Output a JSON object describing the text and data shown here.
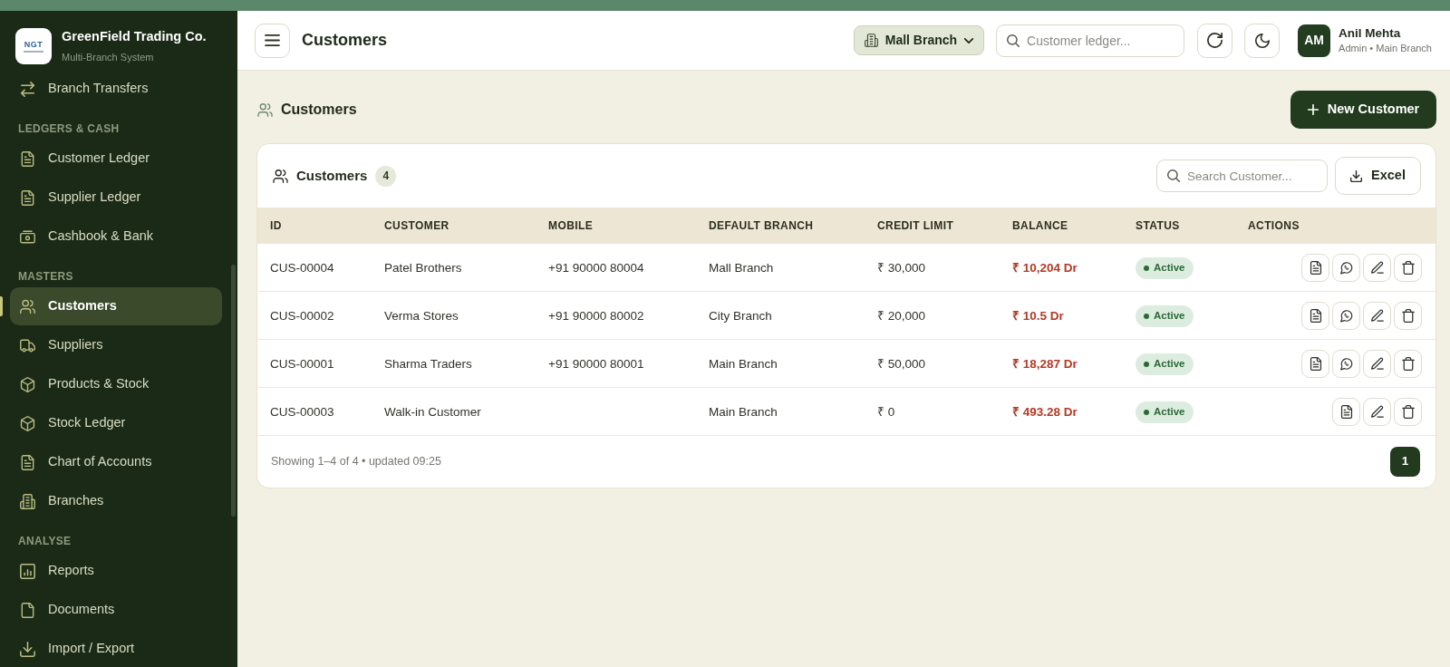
{
  "sidebar": {
    "brand": {
      "logo_text": "NGT",
      "name": "GreenField Trading Co.",
      "tagline": "Multi-Branch System"
    },
    "sections": [
      {
        "items": [
          {
            "label": "Branch Transfers",
            "selected": false
          }
        ]
      },
      {
        "heading": "LEDGERS & CASH",
        "items": [
          {
            "label": "Customer Ledger",
            "selected": false
          },
          {
            "label": "Supplier Ledger",
            "selected": false
          },
          {
            "label": "Cashbook & Bank",
            "selected": false
          }
        ]
      },
      {
        "heading": "MASTERS",
        "items": [
          {
            "label": "Customers",
            "selected": true
          },
          {
            "label": "Suppliers",
            "selected": false
          },
          {
            "label": "Products & Stock",
            "selected": false
          },
          {
            "label": "Stock Ledger",
            "selected": false
          },
          {
            "label": "Chart of Accounts",
            "selected": false
          },
          {
            "label": "Branches",
            "selected": false
          }
        ]
      },
      {
        "heading": "ANALYSE",
        "items": [
          {
            "label": "Reports",
            "selected": false
          },
          {
            "label": "Documents",
            "selected": false
          },
          {
            "label": "Import / Export",
            "selected": false
          }
        ]
      }
    ]
  },
  "header": {
    "title": "Customers",
    "branch_selector": "Mall Branch",
    "search": {
      "placeholder": "Customer ledger..."
    },
    "user": {
      "initials": "AM",
      "name": "Anil Mehta",
      "role": "Admin • Main Branch"
    }
  },
  "page": {
    "title": "Customers",
    "new_button": "New Customer"
  },
  "customers_card": {
    "title": "Customers",
    "count": "4",
    "search": {
      "placeholder": "Search Customer..."
    },
    "export_button": "Excel",
    "table": {
      "columns": [
        "ID",
        "CUSTOMER",
        "MOBILE",
        "DEFAULT BRANCH",
        "CREDIT LIMIT",
        "BALANCE",
        "STATUS",
        "ACTIONS"
      ],
      "rows": [
        {
          "id": "CUS-00004",
          "customer": "Patel Brothers",
          "mobile": "+91 90000 80004",
          "default_branch": "Mall Branch",
          "credit_limit": "₹ 30,000",
          "balance": "₹ 10,204 Dr",
          "status": "Active",
          "actions": [
            {
              "kind": "document"
            },
            {
              "kind": "whatsapp"
            },
            {
              "kind": "edit"
            },
            {
              "kind": "delete"
            }
          ]
        },
        {
          "id": "CUS-00002",
          "customer": "Verma Stores",
          "mobile": "+91 90000 80002",
          "default_branch": "City Branch",
          "credit_limit": "₹ 20,000",
          "balance": "₹ 10.5 Dr",
          "status": "Active",
          "actions": [
            {
              "kind": "document"
            },
            {
              "kind": "whatsapp"
            },
            {
              "kind": "edit"
            },
            {
              "kind": "delete"
            }
          ]
        },
        {
          "id": "CUS-00001",
          "customer": "Sharma Traders",
          "mobile": "+91 90000 80001",
          "default_branch": "Main Branch",
          "credit_limit": "₹ 50,000",
          "balance": "₹ 18,287 Dr",
          "status": "Active",
          "actions": [
            {
              "kind": "document"
            },
            {
              "kind": "whatsapp"
            },
            {
              "kind": "edit"
            },
            {
              "kind": "delete"
            }
          ]
        },
        {
          "id": "CUS-00003",
          "customer": "Walk-in Customer",
          "default_branch": "Main Branch",
          "credit_limit": "₹ 0",
          "balance": "₹ 493.28 Dr",
          "status": "Active",
          "actions": [
            {
              "kind": "document"
            },
            {
              "kind": "edit"
            },
            {
              "kind": "delete"
            }
          ]
        }
      ]
    },
    "footer": {
      "summary": "Showing 1–4 of 4 • updated 09:25",
      "pages": [
        {
          "label": "1",
          "selected": true
        }
      ]
    }
  }
}
